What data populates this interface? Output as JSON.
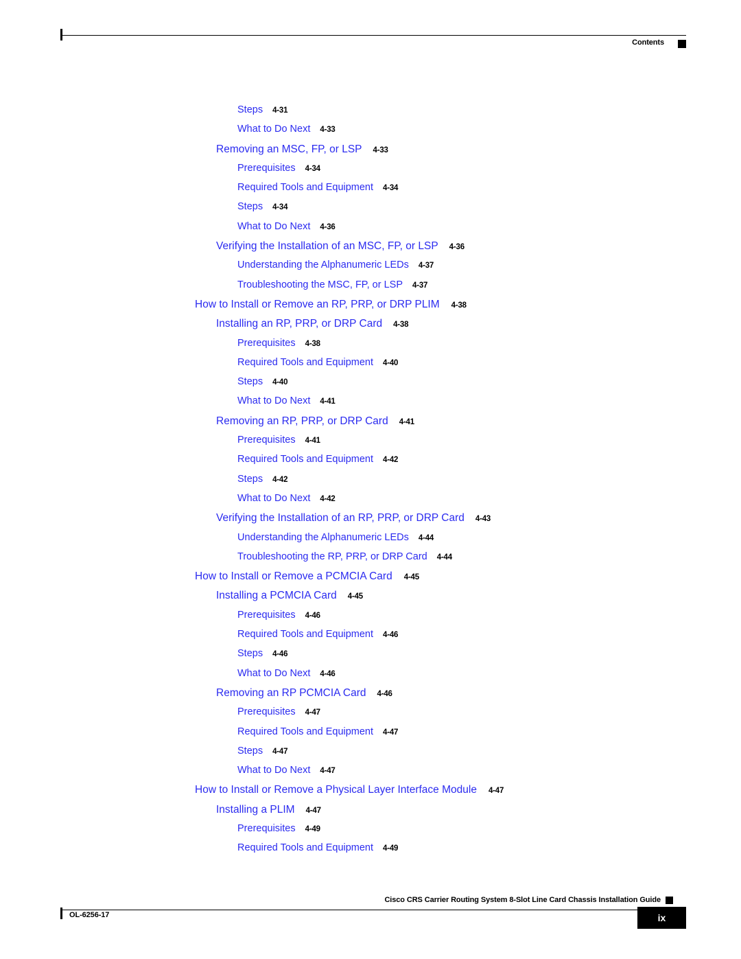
{
  "header": {
    "label": "Contents",
    "marker_icon": "black-square-marker"
  },
  "toc": {
    "entries": [
      {
        "level": 2,
        "title": "Steps",
        "page": "4-31"
      },
      {
        "level": 2,
        "title": "What to Do Next",
        "page": "4-33"
      },
      {
        "level": 1,
        "title": "Removing an MSC, FP, or LSP",
        "page": "4-33"
      },
      {
        "level": 2,
        "title": "Prerequisites",
        "page": "4-34"
      },
      {
        "level": 2,
        "title": "Required Tools and Equipment",
        "page": "4-34"
      },
      {
        "level": 2,
        "title": "Steps",
        "page": "4-34"
      },
      {
        "level": 2,
        "title": "What to Do Next",
        "page": "4-36"
      },
      {
        "level": 1,
        "title": "Verifying the Installation of an MSC, FP, or LSP",
        "page": "4-36"
      },
      {
        "level": 2,
        "title": "Understanding the Alphanumeric LEDs",
        "page": "4-37"
      },
      {
        "level": 2,
        "title": "Troubleshooting the MSC, FP, or LSP",
        "page": "4-37"
      },
      {
        "level": 0,
        "title": "How to Install or Remove an RP, PRP, or DRP PLIM",
        "page": "4-38"
      },
      {
        "level": 1,
        "title": "Installing an RP, PRP, or DRP Card",
        "page": "4-38"
      },
      {
        "level": 2,
        "title": "Prerequisites",
        "page": "4-38"
      },
      {
        "level": 2,
        "title": "Required Tools and Equipment",
        "page": "4-40"
      },
      {
        "level": 2,
        "title": "Steps",
        "page": "4-40"
      },
      {
        "level": 2,
        "title": "What to Do Next",
        "page": "4-41"
      },
      {
        "level": 1,
        "title": "Removing an RP, PRP, or DRP Card",
        "page": "4-41"
      },
      {
        "level": 2,
        "title": "Prerequisites",
        "page": "4-41"
      },
      {
        "level": 2,
        "title": "Required Tools and Equipment",
        "page": "4-42"
      },
      {
        "level": 2,
        "title": "Steps",
        "page": "4-42"
      },
      {
        "level": 2,
        "title": "What to Do Next",
        "page": "4-42"
      },
      {
        "level": 1,
        "title": "Verifying the Installation of an RP, PRP, or DRP Card",
        "page": "4-43"
      },
      {
        "level": 2,
        "title": "Understanding the Alphanumeric LEDs",
        "page": "4-44"
      },
      {
        "level": 2,
        "title": "Troubleshooting the RP, PRP, or DRP Card",
        "page": "4-44"
      },
      {
        "level": 0,
        "title": "How to Install or Remove a PCMCIA Card",
        "page": "4-45"
      },
      {
        "level": 1,
        "title": "Installing a PCMCIA Card",
        "page": "4-45"
      },
      {
        "level": 2,
        "title": "Prerequisites",
        "page": "4-46"
      },
      {
        "level": 2,
        "title": "Required Tools and Equipment",
        "page": "4-46"
      },
      {
        "level": 2,
        "title": "Steps",
        "page": "4-46"
      },
      {
        "level": 2,
        "title": "What to Do Next",
        "page": "4-46"
      },
      {
        "level": 1,
        "title": "Removing an RP PCMCIA Card",
        "page": "4-46"
      },
      {
        "level": 2,
        "title": "Prerequisites",
        "page": "4-47"
      },
      {
        "level": 2,
        "title": "Required Tools and Equipment",
        "page": "4-47"
      },
      {
        "level": 2,
        "title": "Steps",
        "page": "4-47"
      },
      {
        "level": 2,
        "title": "What to Do Next",
        "page": "4-47"
      },
      {
        "level": 0,
        "title": "How to Install or Remove a Physical Layer Interface Module",
        "page": "4-47"
      },
      {
        "level": 1,
        "title": "Installing a PLIM",
        "page": "4-47"
      },
      {
        "level": 2,
        "title": "Prerequisites",
        "page": "4-49"
      },
      {
        "level": 2,
        "title": "Required Tools and Equipment",
        "page": "4-49"
      }
    ]
  },
  "footer": {
    "title": "Cisco CRS Carrier Routing System 8-Slot Line Card Chassis Installation Guide",
    "doc_id": "OL-6256-17",
    "page_number": "ix",
    "marker_icon": "black-square-marker"
  },
  "colors": {
    "link_blue": "#2b2bf0",
    "text_black": "#000000",
    "page_background": "#ffffff"
  }
}
